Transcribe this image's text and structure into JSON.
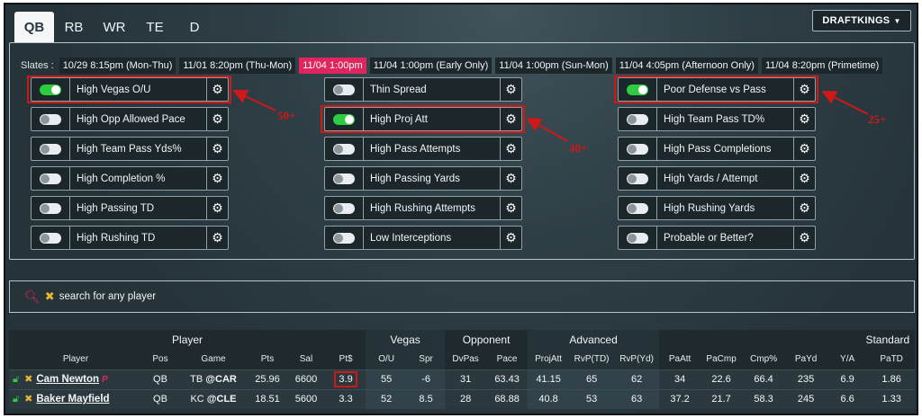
{
  "tabs": [
    {
      "label": "QB",
      "active": true
    },
    {
      "label": "RB",
      "active": false
    },
    {
      "label": "WR",
      "active": false
    },
    {
      "label": "TE",
      "active": false
    },
    {
      "label": "D",
      "active": false
    }
  ],
  "site_select": {
    "label": "DRAFTKINGS",
    "caret": "▼"
  },
  "slates": {
    "label": "Slates :",
    "items": [
      "10/29 8:15pm (Mon-Thu)",
      "11/01 8:20pm (Thu-Mon)",
      "11/04 1:00pm",
      "11/04 1:00pm (Early Only)",
      "11/04 1:00pm (Sun-Mon)",
      "11/04 4:05pm (Afternoon Only)",
      "11/04 8:20pm (Primetime)"
    ],
    "active_index": 2
  },
  "filters": {
    "col1": [
      {
        "label": "High Vegas O/U",
        "on": true
      },
      {
        "label": "High Opp Allowed Pace",
        "on": false
      },
      {
        "label": "High Team Pass Yds%",
        "on": false
      },
      {
        "label": "High Completion %",
        "on": false
      },
      {
        "label": "High Passing TD",
        "on": false
      },
      {
        "label": "High Rushing TD",
        "on": false
      }
    ],
    "col2": [
      {
        "label": "Thin Spread",
        "on": false
      },
      {
        "label": "High Proj Att",
        "on": true
      },
      {
        "label": "High Pass Attempts",
        "on": false
      },
      {
        "label": "High Passing Yards",
        "on": false
      },
      {
        "label": "High Rushing Attempts",
        "on": false
      },
      {
        "label": "Low Interceptions",
        "on": false
      }
    ],
    "col3": [
      {
        "label": "Poor Defense vs Pass",
        "on": true
      },
      {
        "label": "High Team Pass TD%",
        "on": false
      },
      {
        "label": "High Pass Completions",
        "on": false
      },
      {
        "label": "High Yards / Attempt",
        "on": false
      },
      {
        "label": "High Rushing Yards",
        "on": false
      },
      {
        "label": "Probable or Better?",
        "on": false
      }
    ]
  },
  "annotations": {
    "a1": "50+",
    "a2": "40+",
    "a3": "25+"
  },
  "search": {
    "placeholder": "search for any player"
  },
  "table": {
    "groups": [
      "Player",
      "Vegas",
      "Opponent",
      "Advanced",
      "Standard"
    ],
    "columns": [
      "Player",
      "Pos",
      "Game",
      "Pts",
      "Sal",
      "Pt$",
      "O/U",
      "Spr",
      "DvPas",
      "Pace",
      "ProjAtt",
      "RvP(TD)",
      "RvP(Yd)",
      "PaAtt",
      "PaCmp",
      "Cmp%",
      "PaYd",
      "Y/A",
      "PaTD"
    ],
    "rows": [
      {
        "name": "Cam Newton",
        "badge": "P",
        "pos": "QB",
        "team": "TB",
        "opp": "@CAR",
        "pts": "25.96",
        "sal": "6600",
        "ptd": "3.9",
        "ou": "55",
        "spr": "-6",
        "dvpas": "31",
        "pace": "63.43",
        "projatt": "41.15",
        "rvptd": "65",
        "rvpyd": "62",
        "paatt": "34",
        "pacmp": "22.6",
        "cmp": "66.4",
        "payd": "235",
        "ya": "6.9",
        "patd": "1.86"
      },
      {
        "name": "Baker Mayfield",
        "badge": "",
        "pos": "QB",
        "team": "KC",
        "opp": "@CLE",
        "pts": "18.51",
        "sal": "5600",
        "ptd": "3.3",
        "ou": "52",
        "spr": "8.5",
        "dvpas": "28",
        "pace": "68.88",
        "projatt": "40.8",
        "rvptd": "53",
        "rvpyd": "63",
        "paatt": "37.2",
        "pacmp": "21.7",
        "cmp": "58.3",
        "payd": "245",
        "ya": "6.6",
        "patd": "1.33"
      }
    ]
  },
  "colors": {
    "accent": "#e0245e",
    "toggle_on": "#2ecc40",
    "annotation": "#d01818"
  }
}
